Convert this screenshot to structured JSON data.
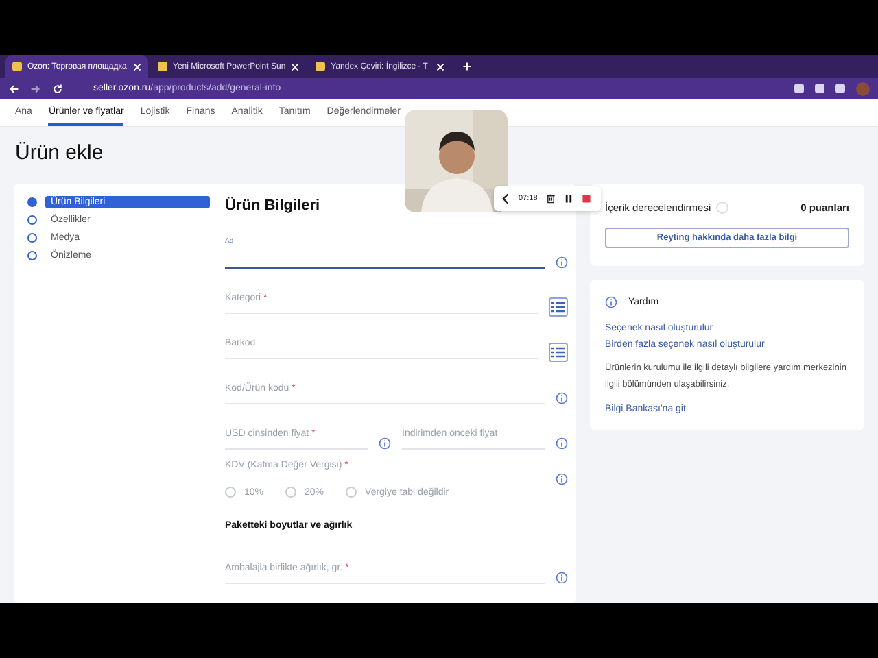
{
  "browser": {
    "tabs": [
      {
        "title": "Ozon: Торговая площадка",
        "selected": true
      },
      {
        "title": "Yeni Microsoft PowerPoint Sun",
        "selected": false
      },
      {
        "title": "Yandex Çeviri: İngilizce - T",
        "selected": false
      }
    ],
    "url_host": "seller.ozon.ru",
    "url_path": "/app/products/add/general-info"
  },
  "nav": [
    {
      "label": "Ana",
      "selected": false
    },
    {
      "label": "Ürünler ve fiyatlar",
      "selected": true
    },
    {
      "label": "Lojistik",
      "selected": false
    },
    {
      "label": "Finans",
      "selected": false
    },
    {
      "label": "Analitik",
      "selected": false
    },
    {
      "label": "Tanıtım",
      "selected": false
    },
    {
      "label": "Değerlendirmeler",
      "selected": false
    }
  ],
  "page_title": "Ürün ekle",
  "steps": [
    {
      "label": "Ürün Bilgileri",
      "selected": true
    },
    {
      "label": "Özellikler",
      "selected": false
    },
    {
      "label": "Medya",
      "selected": false
    },
    {
      "label": "Önizleme",
      "selected": false
    }
  ],
  "form": {
    "title": "Ürün Bilgileri",
    "fields": [
      {
        "kind": "text",
        "label": "Ad",
        "focused": true
      },
      {
        "kind": "select",
        "label": "Kategori",
        "mark": "*",
        "focused": false
      },
      {
        "kind": "select",
        "label": "Barkod",
        "focused": false
      },
      {
        "kind": "text",
        "label": "Kod/Ürün kodu",
        "mark": "*",
        "focused": false
      },
      {
        "kind": "pair",
        "label": "USD cinsinden fiyat",
        "mark": "*",
        "label2": "İndirimden önceki fiyat"
      },
      {
        "kind": "radio",
        "label": "KDV (Katma Değer Vergisi)",
        "mark": "*",
        "options": [
          {
            "label": "10%",
            "selected": false
          },
          {
            "label": "20%",
            "selected": false
          },
          {
            "label": "Vergiye tabi değildir",
            "selected": false
          }
        ]
      },
      {
        "kind": "heading",
        "label": "Paketteki boyutlar ve ağırlık"
      },
      {
        "kind": "text",
        "label": "Ambalajla birlikte ağırlık, gr.",
        "mark": "*",
        "focused": false
      }
    ]
  },
  "rating": {
    "label": "İçerik derecelendirmesi",
    "score": "0 puanları",
    "button": "Reyting hakkında daha fazla bilgi"
  },
  "help": {
    "title": "Yardım",
    "links": [
      "Seçenek nasıl oluşturulur",
      "Birden fazla seçenek nasıl oluşturulur"
    ],
    "text": "Ürünlerin kurulumu ile ilgili detaylı bilgilere yardım merkezinin ilgili bölümünden ulaşabilirsiniz.",
    "link": "Bilgi Bankası'na git"
  },
  "recorder": {
    "time": "07:18"
  }
}
